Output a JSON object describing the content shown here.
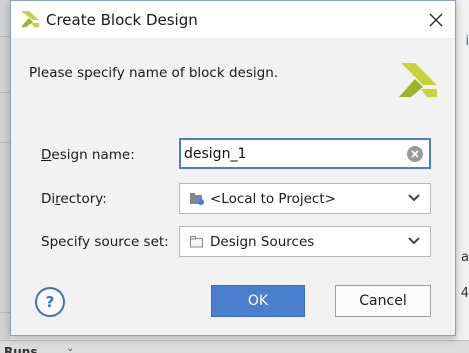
{
  "dialog": {
    "title": "Create Block Design",
    "prompt": "Please specify name of block design.",
    "design_name": {
      "label_prefix": "D",
      "label_rest": "esign name:",
      "value": "design_1"
    },
    "directory": {
      "label_prefix": "Di",
      "label_u": "r",
      "label_rest": "ectory:",
      "value": "<Local to Project>"
    },
    "source_set": {
      "label": "Specify source set:",
      "value": "Design Sources"
    },
    "buttons": {
      "help": "?",
      "ok": "OK",
      "cancel": "Cancel"
    }
  },
  "background": {
    "bottom_tab_label": "Runs",
    "right_glyphs": [
      "i",
      "a",
      "4"
    ]
  },
  "colors": {
    "accent": "#4a7fd0",
    "brand_logo": "#c5d43a"
  }
}
